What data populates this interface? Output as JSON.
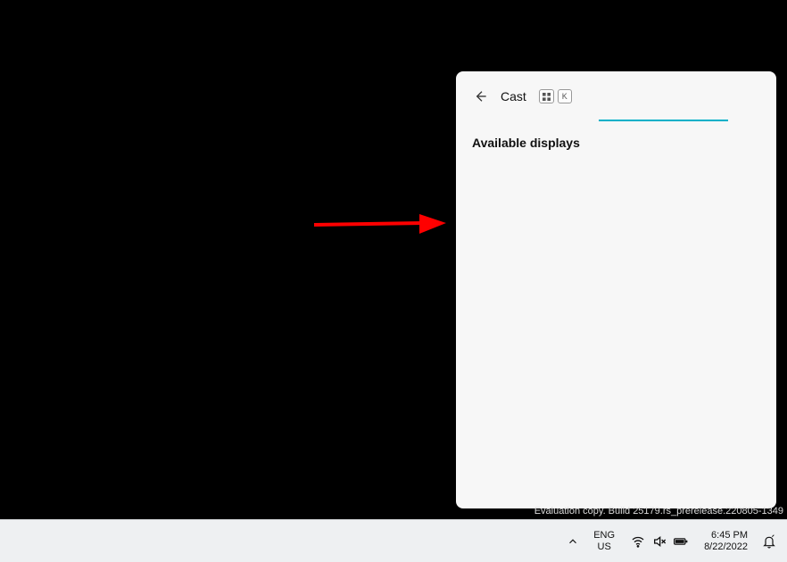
{
  "cast": {
    "title": "Cast",
    "shortcut_key": "K",
    "section_title": "Available displays"
  },
  "watermark": {
    "line2": "Evaluation copy. Build 25179.rs_prerelease.220805-1349"
  },
  "taskbar": {
    "lang_line1": "ENG",
    "lang_line2": "US",
    "time": "6:45 PM",
    "date": "8/22/2022"
  }
}
